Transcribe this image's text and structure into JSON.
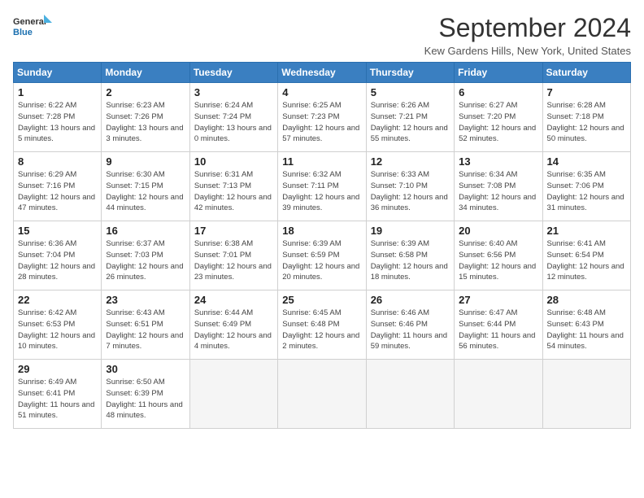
{
  "header": {
    "logo_line1": "General",
    "logo_line2": "Blue",
    "month_title": "September 2024",
    "location": "Kew Gardens Hills, New York, United States"
  },
  "weekdays": [
    "Sunday",
    "Monday",
    "Tuesday",
    "Wednesday",
    "Thursday",
    "Friday",
    "Saturday"
  ],
  "weeks": [
    [
      {
        "day": 1,
        "sunrise": "6:22 AM",
        "sunset": "7:28 PM",
        "daylight": "13 hours and 5 minutes."
      },
      {
        "day": 2,
        "sunrise": "6:23 AM",
        "sunset": "7:26 PM",
        "daylight": "13 hours and 3 minutes."
      },
      {
        "day": 3,
        "sunrise": "6:24 AM",
        "sunset": "7:24 PM",
        "daylight": "13 hours and 0 minutes."
      },
      {
        "day": 4,
        "sunrise": "6:25 AM",
        "sunset": "7:23 PM",
        "daylight": "12 hours and 57 minutes."
      },
      {
        "day": 5,
        "sunrise": "6:26 AM",
        "sunset": "7:21 PM",
        "daylight": "12 hours and 55 minutes."
      },
      {
        "day": 6,
        "sunrise": "6:27 AM",
        "sunset": "7:20 PM",
        "daylight": "12 hours and 52 minutes."
      },
      {
        "day": 7,
        "sunrise": "6:28 AM",
        "sunset": "7:18 PM",
        "daylight": "12 hours and 50 minutes."
      }
    ],
    [
      {
        "day": 8,
        "sunrise": "6:29 AM",
        "sunset": "7:16 PM",
        "daylight": "12 hours and 47 minutes."
      },
      {
        "day": 9,
        "sunrise": "6:30 AM",
        "sunset": "7:15 PM",
        "daylight": "12 hours and 44 minutes."
      },
      {
        "day": 10,
        "sunrise": "6:31 AM",
        "sunset": "7:13 PM",
        "daylight": "12 hours and 42 minutes."
      },
      {
        "day": 11,
        "sunrise": "6:32 AM",
        "sunset": "7:11 PM",
        "daylight": "12 hours and 39 minutes."
      },
      {
        "day": 12,
        "sunrise": "6:33 AM",
        "sunset": "7:10 PM",
        "daylight": "12 hours and 36 minutes."
      },
      {
        "day": 13,
        "sunrise": "6:34 AM",
        "sunset": "7:08 PM",
        "daylight": "12 hours and 34 minutes."
      },
      {
        "day": 14,
        "sunrise": "6:35 AM",
        "sunset": "7:06 PM",
        "daylight": "12 hours and 31 minutes."
      }
    ],
    [
      {
        "day": 15,
        "sunrise": "6:36 AM",
        "sunset": "7:04 PM",
        "daylight": "12 hours and 28 minutes."
      },
      {
        "day": 16,
        "sunrise": "6:37 AM",
        "sunset": "7:03 PM",
        "daylight": "12 hours and 26 minutes."
      },
      {
        "day": 17,
        "sunrise": "6:38 AM",
        "sunset": "7:01 PM",
        "daylight": "12 hours and 23 minutes."
      },
      {
        "day": 18,
        "sunrise": "6:39 AM",
        "sunset": "6:59 PM",
        "daylight": "12 hours and 20 minutes."
      },
      {
        "day": 19,
        "sunrise": "6:39 AM",
        "sunset": "6:58 PM",
        "daylight": "12 hours and 18 minutes."
      },
      {
        "day": 20,
        "sunrise": "6:40 AM",
        "sunset": "6:56 PM",
        "daylight": "12 hours and 15 minutes."
      },
      {
        "day": 21,
        "sunrise": "6:41 AM",
        "sunset": "6:54 PM",
        "daylight": "12 hours and 12 minutes."
      }
    ],
    [
      {
        "day": 22,
        "sunrise": "6:42 AM",
        "sunset": "6:53 PM",
        "daylight": "12 hours and 10 minutes."
      },
      {
        "day": 23,
        "sunrise": "6:43 AM",
        "sunset": "6:51 PM",
        "daylight": "12 hours and 7 minutes."
      },
      {
        "day": 24,
        "sunrise": "6:44 AM",
        "sunset": "6:49 PM",
        "daylight": "12 hours and 4 minutes."
      },
      {
        "day": 25,
        "sunrise": "6:45 AM",
        "sunset": "6:48 PM",
        "daylight": "12 hours and 2 minutes."
      },
      {
        "day": 26,
        "sunrise": "6:46 AM",
        "sunset": "6:46 PM",
        "daylight": "11 hours and 59 minutes."
      },
      {
        "day": 27,
        "sunrise": "6:47 AM",
        "sunset": "6:44 PM",
        "daylight": "11 hours and 56 minutes."
      },
      {
        "day": 28,
        "sunrise": "6:48 AM",
        "sunset": "6:43 PM",
        "daylight": "11 hours and 54 minutes."
      }
    ],
    [
      {
        "day": 29,
        "sunrise": "6:49 AM",
        "sunset": "6:41 PM",
        "daylight": "11 hours and 51 minutes."
      },
      {
        "day": 30,
        "sunrise": "6:50 AM",
        "sunset": "6:39 PM",
        "daylight": "11 hours and 48 minutes."
      },
      null,
      null,
      null,
      null,
      null
    ]
  ]
}
